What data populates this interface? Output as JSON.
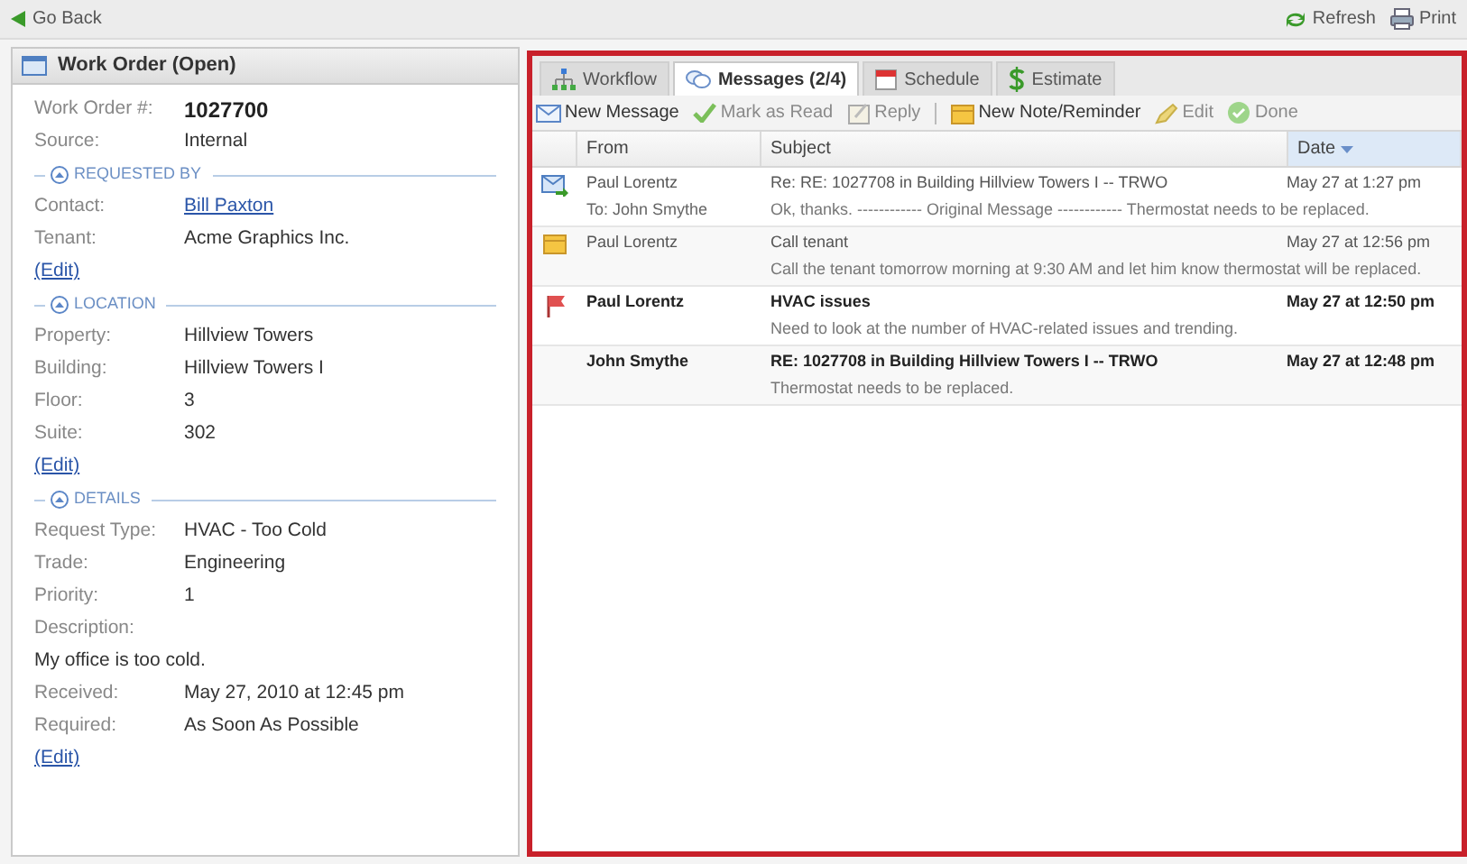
{
  "top_bar": {
    "back_link": "Go Back",
    "actions": [
      {
        "kind": "refresh",
        "label": "Refresh"
      },
      {
        "kind": "print",
        "label": "Print"
      }
    ]
  },
  "work_order": {
    "title": "Work Order (Open)",
    "items": [
      {
        "kind": "id_field",
        "label": "Work Order #:",
        "value": "1027700"
      },
      {
        "kind": "field",
        "label": "Source:",
        "value": "Internal"
      },
      {
        "kind": "section",
        "label": "REQUESTED BY",
        "expanded": true
      },
      {
        "kind": "link_field",
        "label": "Contact:",
        "value": "Bill Paxton"
      },
      {
        "kind": "field",
        "label": "Tenant:",
        "value": "Acme Graphics Inc."
      },
      {
        "kind": "edit",
        "label": "(Edit)"
      },
      {
        "kind": "section",
        "label": "LOCATION",
        "expanded": true
      },
      {
        "kind": "field",
        "label": "Property:",
        "value": "Hillview Towers"
      },
      {
        "kind": "field",
        "label": "Building:",
        "value": "Hillview Towers I"
      },
      {
        "kind": "field",
        "label": "Floor:",
        "value": "3"
      },
      {
        "kind": "field",
        "label": "Suite:",
        "value": "302"
      },
      {
        "kind": "edit",
        "label": "(Edit)"
      },
      {
        "kind": "section",
        "label": "DETAILS",
        "expanded": true
      },
      {
        "kind": "field",
        "label": "Request Type:",
        "value": "HVAC - Too Cold"
      },
      {
        "kind": "field",
        "label": "Trade:",
        "value": "Engineering"
      },
      {
        "kind": "field",
        "label": "Priority:",
        "value": "1"
      },
      {
        "kind": "label",
        "label": "Description:"
      },
      {
        "kind": "text",
        "label": "My office is too cold."
      },
      {
        "kind": "field",
        "label": "Received:",
        "value": "May 27, 2010 at 12:45 pm"
      },
      {
        "kind": "field",
        "label": "Required:",
        "value": "As Soon As Possible"
      },
      {
        "kind": "edit",
        "label": "(Edit)"
      }
    ]
  },
  "tabs": [
    {
      "kind": "workflow",
      "label": "Workflow",
      "selected": false
    },
    {
      "kind": "messages",
      "label": "Messages (2/4)",
      "selected": true
    },
    {
      "kind": "schedule",
      "label": "Schedule",
      "selected": false
    },
    {
      "kind": "estimate",
      "label": "Estimate",
      "selected": false
    }
  ],
  "toolbar": [
    {
      "kind": "new-message",
      "label": "New Message",
      "disabled": false
    },
    {
      "kind": "mark-read",
      "label": "Mark as Read",
      "disabled": true
    },
    {
      "kind": "reply",
      "label": "Reply",
      "disabled": true
    },
    {
      "kind": "separator"
    },
    {
      "kind": "note",
      "label": "New Note/Reminder",
      "disabled": false
    },
    {
      "kind": "edit",
      "label": "Edit",
      "disabled": true
    },
    {
      "kind": "done",
      "label": "Done",
      "disabled": true
    }
  ],
  "columns": [
    {
      "label": "From",
      "sorted": false
    },
    {
      "label": "Subject",
      "sorted": false
    },
    {
      "label": "Date",
      "sorted": true
    }
  ],
  "messages": [
    {
      "kind": "reply",
      "from": "Paul Lorentz",
      "to": "To: John Smythe",
      "subject": "Re: RE: 1027708 in Building Hillview Towers I -- TRWO",
      "preview": "Ok, thanks. ------------ Original Message ------------ Thermostat needs to be replaced.",
      "date": "May 27 at 1:27 pm",
      "unread": false
    },
    {
      "kind": "note",
      "from": "Paul Lorentz",
      "subject": "Call tenant",
      "preview": "Call the tenant tomorrow morning at 9:30 AM and let him know thermostat will be replaced.",
      "date": "May 27 at 12:56 pm",
      "unread": false
    },
    {
      "kind": "flag",
      "from": "Paul Lorentz",
      "subject": "HVAC issues",
      "preview": "Need to look at the number of HVAC-related issues and trending.",
      "date": "May 27 at 12:50 pm",
      "unread": true
    },
    {
      "kind": "none",
      "from": "John Smythe",
      "subject": "RE: 1027708 in Building Hillview Towers I -- TRWO",
      "preview": "Thermostat needs to be replaced.",
      "date": "May 27 at 12:48 pm",
      "unread": true
    }
  ]
}
